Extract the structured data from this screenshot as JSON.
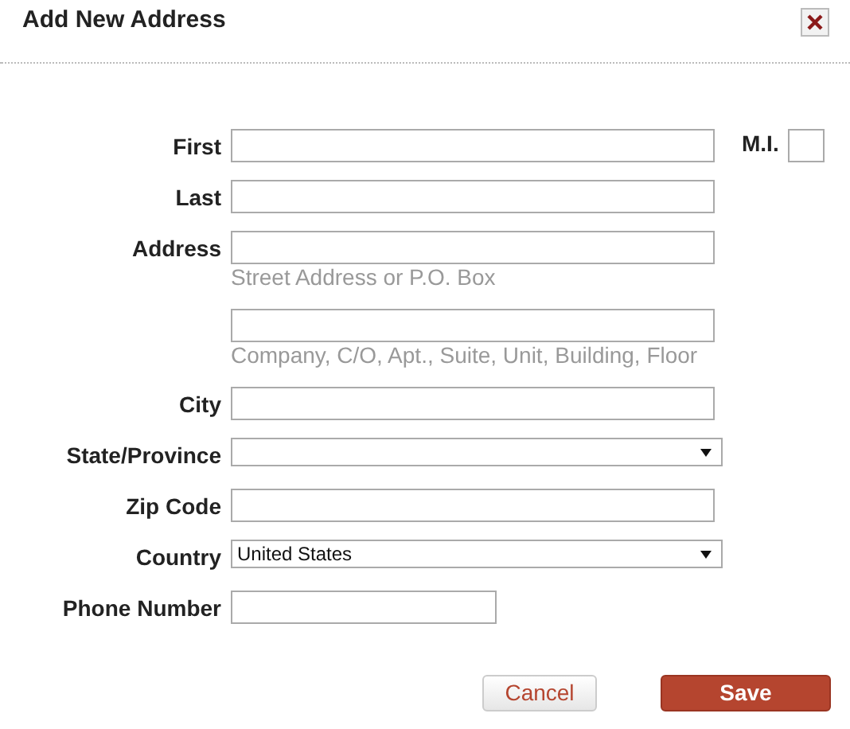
{
  "dialog": {
    "title": "Add New Address"
  },
  "fields": [
    {
      "kind": "text",
      "label": "First",
      "side_label": "M.I."
    },
    {
      "kind": "text",
      "label": "Last"
    },
    {
      "kind": "text",
      "label": "Address",
      "hint": "Street Address or P.O. Box"
    },
    {
      "kind": "text",
      "hint": "Company, C/O, Apt., Suite, Unit, Building, Floor"
    },
    {
      "kind": "text",
      "label": "City"
    },
    {
      "kind": "select",
      "label": "State/Province"
    },
    {
      "kind": "text",
      "label": "Zip Code"
    },
    {
      "kind": "select",
      "label": "Country",
      "value": "United States"
    },
    {
      "kind": "short",
      "label": "Phone Number"
    }
  ],
  "buttons": [
    {
      "label": "Cancel",
      "kind": "secondary"
    },
    {
      "label": "Save",
      "kind": "primary"
    }
  ]
}
